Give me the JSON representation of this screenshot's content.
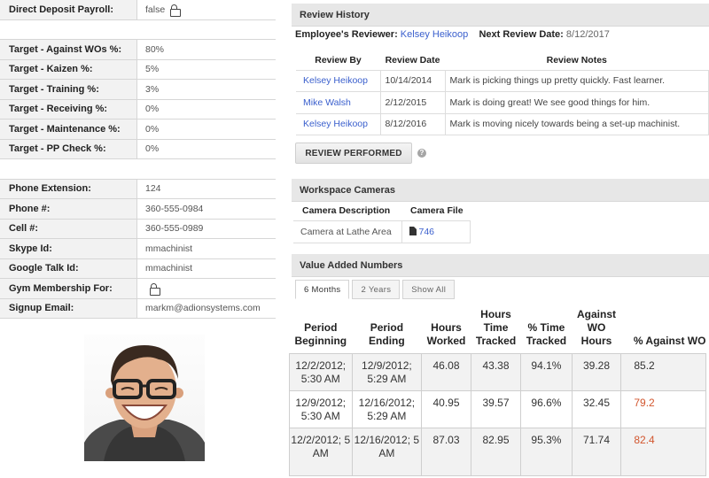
{
  "profile": {
    "direct_deposit": {
      "label": "Direct Deposit Payroll:",
      "value": "false"
    },
    "targets": [
      {
        "label": "Target - Against WOs %:",
        "value": "80%"
      },
      {
        "label": "Target - Kaizen %:",
        "value": "5%"
      },
      {
        "label": "Target - Training %:",
        "value": "3%"
      },
      {
        "label": "Target - Receiving %:",
        "value": "0%"
      },
      {
        "label": "Target - Maintenance %:",
        "value": "0%"
      },
      {
        "label": "Target - PP Check %:",
        "value": "0%"
      }
    ],
    "contact": [
      {
        "label": "Phone Extension:",
        "value": "124"
      },
      {
        "label": "Phone #:",
        "value": "360-555-0984"
      },
      {
        "label": "Cell #:",
        "value": "360-555-0989"
      },
      {
        "label": "Skype Id:",
        "value": "mmachinist"
      },
      {
        "label": "Google Talk Id:",
        "value": "mmachinist"
      },
      {
        "label": "Gym Membership For:",
        "value": ""
      },
      {
        "label": "Signup Email:",
        "value": "markm@adionsystems.com"
      }
    ]
  },
  "review_history": {
    "title": "Review History",
    "reviewer_label": "Employee's Reviewer:",
    "reviewer_name": "Kelsey Heikoop",
    "next_review_label": "Next Review Date:",
    "next_review_date": "8/12/2017",
    "columns": [
      "Review By",
      "Review Date",
      "Review Notes"
    ],
    "rows": [
      {
        "by": "Kelsey Heikoop",
        "date": "10/14/2014",
        "notes": "Mark is picking things up pretty quickly. Fast learner."
      },
      {
        "by": "Mike Walsh",
        "date": "2/12/2015",
        "notes": "Mark is doing great! We see good things for him."
      },
      {
        "by": "Kelsey Heikoop",
        "date": "8/12/2016",
        "notes": "Mark is moving nicely towards being a set-up machinist."
      }
    ],
    "button_label": "REVIEW PERFORMED",
    "help_glyph": "?"
  },
  "cameras": {
    "title": "Workspace Cameras",
    "columns": [
      "Camera Description",
      "Camera File"
    ],
    "rows": [
      {
        "description": "Camera at Lathe Area",
        "file": "746"
      }
    ]
  },
  "value_added": {
    "title": "Value Added Numbers",
    "tabs": [
      "6 Months",
      "2 Years",
      "Show All"
    ],
    "active_tab": "6 Months",
    "columns": [
      "Period Beginning",
      "Period Ending",
      "Hours Worked",
      "Hours Time Tracked",
      "% Time Tracked",
      "Against WO Hours",
      "% Against WO"
    ],
    "rows": [
      {
        "begin": "12/2/2012; 5:30 AM",
        "end": "12/9/2012; 5:29 AM",
        "worked": "46.08",
        "tracked": "43.38",
        "pct_tracked": "94.1%",
        "against": "39.28",
        "pct_against": "85.2"
      },
      {
        "begin": "12/9/2012; 5:30 AM",
        "end": "12/16/2012; 5:29 AM",
        "worked": "40.95",
        "tracked": "39.57",
        "pct_tracked": "96.6%",
        "against": "32.45",
        "pct_against": "79.2"
      },
      {
        "begin": "12/2/2012; 5 AM",
        "end": "12/16/2012; 5 AM",
        "worked": "87.03",
        "tracked": "82.95",
        "pct_tracked": "95.3%",
        "against": "71.74",
        "pct_against": "82.4"
      }
    ],
    "alert_color": "#d2562e"
  },
  "colors": {
    "link": "#3a5fcd",
    "header_bg": "#e7e7e7",
    "label_bg": "#f2f2f2"
  },
  "icons": [
    "lock-icon",
    "help-icon",
    "file-icon"
  ]
}
